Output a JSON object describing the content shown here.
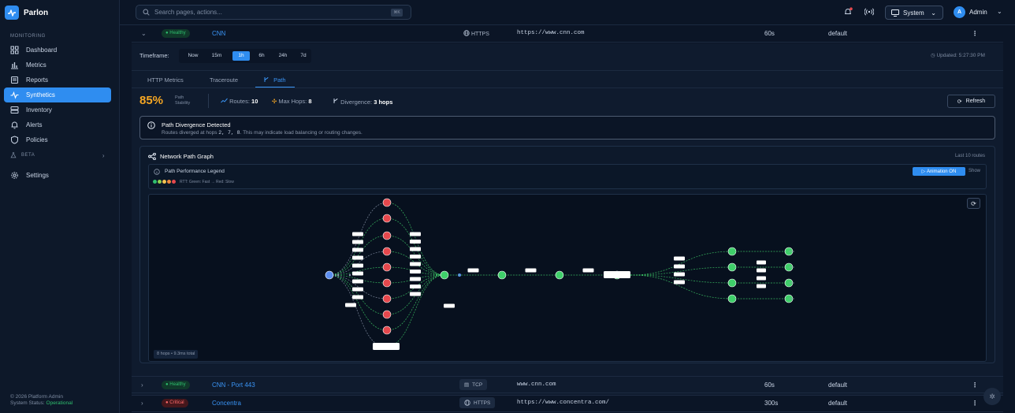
{
  "brand": {
    "name": "Parlon"
  },
  "search": {
    "placeholder": "Search pages, actions...",
    "shortcut": "⌘K"
  },
  "header": {
    "system_label": "System",
    "user_initial": "A",
    "user_name": "Admin"
  },
  "sidebar": {
    "section_monitoring": "MONITORING",
    "items": [
      {
        "label": "Dashboard",
        "icon": "grid-icon"
      },
      {
        "label": "Metrics",
        "icon": "bar-chart-icon"
      },
      {
        "label": "Reports",
        "icon": "report-icon"
      },
      {
        "label": "Synthetics",
        "icon": "pulse-icon",
        "active": true
      },
      {
        "label": "Inventory",
        "icon": "server-icon"
      },
      {
        "label": "Alerts",
        "icon": "bell-icon"
      },
      {
        "label": "Policies",
        "icon": "shield-icon"
      }
    ],
    "section_beta": "BETA",
    "settings_label": "Settings",
    "footer_copyright": "© 2026 Platform Admin",
    "footer_status_label": "System Status:",
    "footer_status_value": "Operational"
  },
  "monitors": [
    {
      "status": "Healthy",
      "name": "CNN",
      "protocol": "HTTPS",
      "target": "https://www.cnn.com",
      "interval": "60s",
      "location": "default",
      "expanded": true
    },
    {
      "status": "Healthy",
      "name": "CNN - Port 443",
      "protocol": "TCP",
      "target": "www.cnn.com",
      "interval": "60s",
      "location": "default"
    },
    {
      "status": "Critical",
      "name": "Concentra",
      "protocol": "HTTPS",
      "target": "https://www.concentra.com/",
      "interval": "300s",
      "location": "default"
    }
  ],
  "detail": {
    "timeframe_label": "Timeframe:",
    "timeframes": [
      "Now",
      "15m",
      "1h",
      "6h",
      "24h",
      "7d"
    ],
    "timeframe_active": "1h",
    "updated": "Updated: 5:27:30 PM",
    "tabs": [
      "HTTP Metrics",
      "Traceroute",
      "Path"
    ],
    "tab_active": "Path",
    "stability_value": "85%",
    "stability_label_1": "Path",
    "stability_label_2": "Stability",
    "routes_label": "Routes:",
    "routes_value": "10",
    "max_hops_label": "Max Hops:",
    "max_hops_value": "8",
    "divergence_label": "Divergence:",
    "divergence_value": "3 hops",
    "refresh_label": "Refresh",
    "alert_title": "Path Divergence Detected",
    "alert_prefix": "Routes diverged at hops",
    "alert_hops": "2, 7, 8",
    "alert_suffix": ". This may indicate load balancing or routing changes."
  },
  "graph": {
    "title": "Network Path Graph",
    "subtitle": "Last 10 routes",
    "legend_title": "Path Performance Legend",
    "legend_caption": "RTT: Green: Fast → Red: Slow",
    "legend_colors": [
      "#2fbf6e",
      "#8fd14f",
      "#f5c451",
      "#f08a3c",
      "#e5484d"
    ],
    "animation_label": "Animation ON",
    "show_label": "Show",
    "footer_stat": "8 hops • 9.3ms total"
  },
  "colors": {
    "accent": "#2f8df0",
    "healthy": "#2fbf6e",
    "critical": "#e5484d",
    "warning": "#f5a623"
  }
}
